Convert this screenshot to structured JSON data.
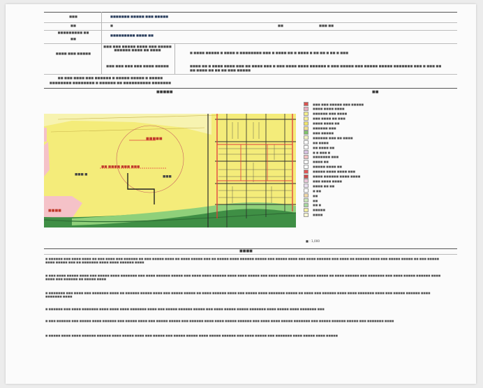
{
  "table": {
    "row1": {
      "label": "■■■",
      "value": "■■■■■■■ ■■■■■ ■■■ ■■■■■"
    },
    "row2": {
      "label": "■■",
      "value": "■",
      "label2": "■■",
      "value2": "■■■ ■■"
    },
    "row3": {
      "label": "■■■■■■■■■ ■■",
      "sublabel": "■■",
      "value": "■■■■■■■■■ ■■■■ ■■"
    },
    "row4": {
      "label": "■■■■ ■■■ ■■■■■",
      "sub1": "■■■ ■■■ ■■■■■ ■■■■ ■■■ ■■■■■ ■■■■■■ ■■■■ ■■ ■■■■",
      "value1": "■ ■■■■ ■■■■■ ■ ■■■■ ■ ■■■■■■■■ ■■■ ■ ■■■■ ■■ ■ ■■■■ ■ ■■ ■■ ■ ■■ ■ ■■■",
      "sub2": "■■■ ■■■ ■■■ ■■■ ■■■■ ■■■■■",
      "value2a": "■■■■ ■■ ■ ■■■■ ■■■■ ■■■ ■■ ■■■■ ■■■ ■ ■■■ ■■■■ ■■■■ ■■■■■■ ■ ■■■ ■■■■■ ■■■ ■■■■■ ■■■■■ ■■■■■■■ ■■■ ■ ■■■ ■■■ ■■■",
      "value2b": "■■ ■■■■ ■■ ■■ ■■ ■■■ ■■■■■"
    },
    "note1": "■■ ■■■ ■■■■ ■■■ ■■■■■■ ■ ■■■■■ ■■■■■ ■ ■■■■■",
    "note2": "■■■■■■■■ ■■■■■■■■ ■ ■■■■■■ ■■ ■■■■■■■■■■ ■■■■■■■"
  },
  "sections": {
    "map_header": "■■■■■",
    "legend_header": "■■",
    "text_header": "■■■■"
  },
  "map": {
    "labels": [
      "■■■■■",
      "■■ ■■■■ ■■■ ■■■",
      "■■■ ■",
      "■■■■",
      "■■■"
    ],
    "colors": {
      "base_yellow": "#f4ec7a",
      "pale_yellow": "#f7f3b0",
      "pink": "#f5c2c8",
      "green_band": "#4fa64d",
      "red_line": "#e23b3b",
      "dark": "#2a2a2a"
    }
  },
  "legend": [
    {
      "label": "■■■ ■■■ ■■■■■ ■■■ ■■■■■",
      "color": "#d9534f"
    },
    {
      "label": "■■■■ ■■■■ ■■■■",
      "color": "#e6b0c0"
    },
    {
      "label": "■■■■■■ ■■■ ■■■■",
      "color": "#f2ed8a"
    },
    {
      "label": "■■■ ■■■■ ■■ ■■■",
      "color": "#f6f09a"
    },
    {
      "label": "■■■■ ■■■■ ■■",
      "color": "#efe36c"
    },
    {
      "label": "■■■■■■ ■■■",
      "color": "#f0e08e"
    },
    {
      "label": "■■■ ■■■■■",
      "color": "#7fc36b"
    },
    {
      "label": "■■■■■■ ■■■ ■■ ■■■■",
      "color": "#f3f3c2"
    },
    {
      "label": "■■ ■■■■",
      "color": "#ffffff"
    },
    {
      "label": "■■ ■■■■ ■■",
      "color": "#ffffff"
    },
    {
      "label": "■ ■ ■■■ ■",
      "color": "#d6c1e0"
    },
    {
      "label": "■■■■■■■ ■■■",
      "color": "#f2c0c0"
    },
    {
      "label": "■■■■ ■■",
      "color": "#f8f8f8"
    },
    {
      "label": "■■■■■ ■■■■ ■■",
      "color": "#ffffff"
    },
    {
      "label": "■■■■■ ■■■■ ■■■■ ■■■",
      "color": "#e05858"
    },
    {
      "label": "■■■■ ■■■■■■ ■■■■ ■■■■",
      "color": "#c94b4b"
    },
    {
      "label": "■■■ ■■■■ ■■■■",
      "color": "#e9c6d8"
    },
    {
      "label": "■■■■ ■■ ■■",
      "color": "#eadff0"
    },
    {
      "label": "■ ■■",
      "color": "#ffffff"
    },
    {
      "label": "■■",
      "color": "#f2d9a8"
    },
    {
      "label": "■■",
      "color": "#c9e6b8"
    },
    {
      "label": "■■ ■",
      "color": "#a8d8a0"
    },
    {
      "label": "■■■■■",
      "color": "#f3ef9e"
    },
    {
      "label": "■■■■",
      "color": "#fbf7d3"
    }
  ],
  "scale": "■ : 1,000",
  "paragraphs": [
    "■ ■■■■■■ ■■■ ■■■■ ■■■■ ■■ ■■■ ■■■■ ■■■ ■■■■■■ ■■ ■■■ ■■■■■ ■■■■ ■■ ■■■■ ■■■■■ ■■■ ■■ ■■■■■ ■■■■ ■■■■■■ ■■■■■ ■■■ ■■■■■ ■■■■ ■■■ ■■■■ ■■■■■■ ■■■ ■■■■ ■■ ■■■■■■ ■■■■ ■■■ ■■■■■ ■■■■■ ■■ ■■■ ■■■■■ ■■■■ ■■■■■ ■■■ ■■ ■■■■■■■ ■■■■ ■■■■ ■■■■■■ ■■■■",
    "■ ■■■ ■■■■ ■■■■■ ■■■■ ■■■ ■■■■■ ■■■■ ■■■■■■■ ■■■ ■■■■ ■■■■■■ ■■■■■ ■■■ ■■■■ ■■■■ ■■■■■■ ■■■■ ■■■■ ■■■■■ ■■■ ■■■■ ■■■■■■■ ■■■ ■■■■■ ■■■■■ ■■ ■■■■ ■■■■■■ ■■■ ■■■■■■■ ■■■ ■■■■ ■■■■■ ■■■■■■ ■■■■ ■■■■ ■■■ ■■■■■■ ■■ ■■■■■ ■■■■",
    "■ ■■■■■■■ ■■■ ■■■■ ■■■ ■■■■■■■ ■■■■ ■■ ■■■■■■ ■■■■■ ■■■■ ■■■ ■■■■■ ■■■■■ ■■ ■■■■ ■■■■■■ ■■■■ ■■■ ■■■■■ ■■■■ ■■■■■■■ ■■■■■ ■■ ■■■■ ■■■ ■■■■■■ ■■■■ ■■■■ ■■■■■■■ ■■■■ ■■■ ■■■■■ ■■■■■■ ■■■■ ■■■■■■■ ■■■■",
    "■ ■■■■■■ ■■■ ■■■■ ■■■■■■■ ■■■■ ■■■■ ■■■■ ■■■■■■■ ■■■■ ■■■ ■■■■■ ■■■■■■ ■■■■■ ■■■ ■■■■ ■■■■■ ■■■■■ ■■■■■■■ ■■■■ ■■■■■ ■■■■ ■■■■■■■ ■■■",
    "■ ■■■ ■■■■■■ ■■■ ■■■■■ ■■■■ ■■■■■■ ■■■ ■■■■■ ■■■■ ■■■ ■■■■■ ■■■■■ ■■■ ■■■■■■ ■■■■ ■■■■ ■■■■■ ■■■■■■ ■■■ ■■■■ ■■■■ ■■■■■ ■■■■■■■ ■■■ ■■■■■ ■■■■■■ ■■■■■ ■■■ ■■■■■■■ ■■■■",
    "■ ■■■■■ ■■■■ ■■■■ ■■■■■■ ■■■■■■ ■■■■ ■■■■■ ■■■■ ■■■ ■■■■■ ■■■ ■■■■■ ■■■■■ ■■■■ ■■■■■ ■■■■■■ ■■■ ■■■■ ■■■■■ ■■■ ■■■■■■■ ■■■■ ■■■■■ ■■■■ ■■■■■"
  ]
}
